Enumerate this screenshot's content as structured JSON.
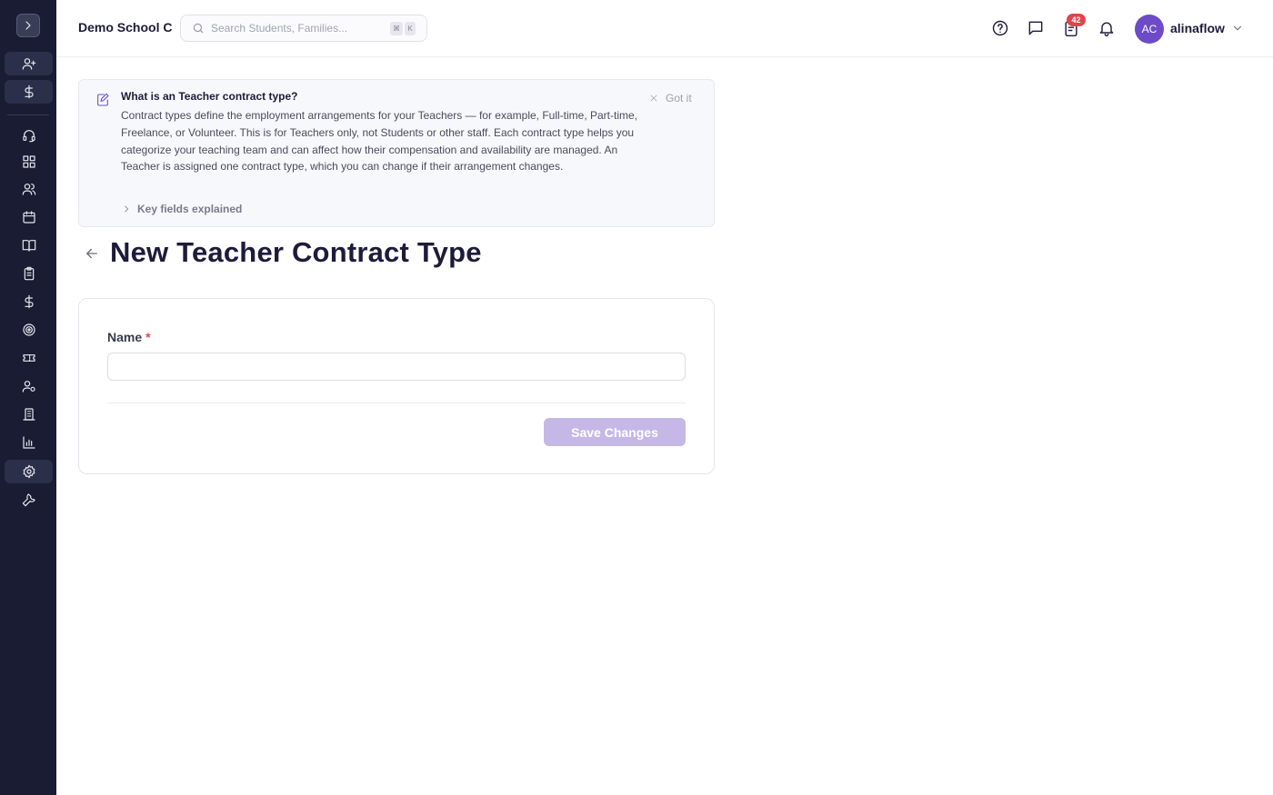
{
  "app": {
    "school_name": "Demo School C"
  },
  "search": {
    "placeholder": "Search Students, Families...",
    "shortcut_mod": "⌘",
    "shortcut_key": "K"
  },
  "header": {
    "tasks_badge": "42",
    "avatar_initials": "AC",
    "username": "alinaflow"
  },
  "sidebar": {
    "items": [
      {
        "icon": "user-plus-icon"
      },
      {
        "icon": "dollar-icon"
      },
      {
        "icon": "headset-icon"
      },
      {
        "icon": "dashboard-icon"
      },
      {
        "icon": "users-icon"
      },
      {
        "icon": "calendar-icon"
      },
      {
        "icon": "book-open-icon"
      },
      {
        "icon": "clipboard-icon"
      },
      {
        "icon": "dollar-icon"
      },
      {
        "icon": "target-icon"
      },
      {
        "icon": "ticket-icon"
      },
      {
        "icon": "user-gear-icon"
      },
      {
        "icon": "building-icon"
      },
      {
        "icon": "bar-chart-icon"
      },
      {
        "icon": "settings-icon",
        "active": true
      },
      {
        "icon": "wrench-icon"
      }
    ]
  },
  "info": {
    "title": "What is an Teacher contract type?",
    "body": "Contract types define the employment arrangements for your Teachers — for example, Full-time, Part-time, Freelance, or Volunteer. This is for Teachers only, not Students or other staff. Each contract type helps you categorize your teaching team and can affect how their compensation and availability are managed. An Teacher is assigned one contract type, which you can change if their arrangement changes.",
    "dismiss_label": "Got it",
    "key_fields_label": "Key fields explained"
  },
  "page": {
    "title": "New Teacher Contract Type"
  },
  "form": {
    "name_label": "Name",
    "required_mark": "*",
    "name_value": "",
    "save_label": "Save Changes"
  },
  "colors": {
    "sidebar_bg": "#1a1c33",
    "accent": "#6d4bc6",
    "save_disabled": "#c5b8e6",
    "badge": "#e0444e"
  }
}
